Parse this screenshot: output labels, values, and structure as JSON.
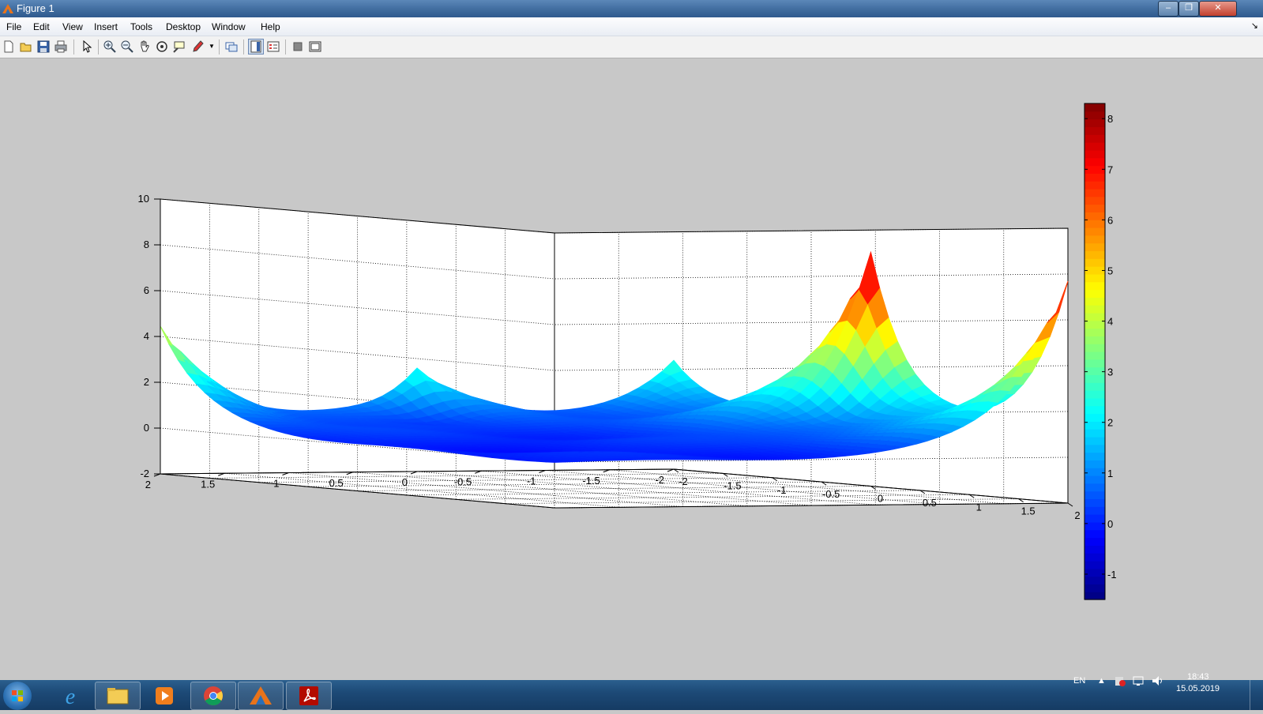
{
  "window": {
    "title": "Figure 1",
    "controls": [
      "minimize",
      "maximize",
      "close"
    ]
  },
  "menu": [
    "File",
    "Edit",
    "View",
    "Insert",
    "Tools",
    "Desktop",
    "Window",
    "Help"
  ],
  "toolbar": [
    "new-figure-icon",
    "open-file-icon",
    "save-icon",
    "print-icon",
    "edit-plot-icon",
    "zoom-in-icon",
    "zoom-out-icon",
    "pan-icon",
    "rotate-3d-icon",
    "data-cursor-icon",
    "brush-icon",
    "link-plot-icon",
    "colorbar-icon",
    "legend-icon",
    "hide-plot-tools-icon",
    "show-plot-tools-icon"
  ],
  "chart_data": {
    "type": "surface",
    "x_ticks": [
      "-2",
      "-1.5",
      "-1",
      "-0.5",
      "0",
      "0.5",
      "1",
      "1.5",
      "2"
    ],
    "y_ticks": [
      "-2",
      "-1.5",
      "-1",
      "-0.5",
      "0",
      "0.5",
      "1",
      "1.5",
      "2"
    ],
    "z_ticks": [
      "-2",
      "0",
      "2",
      "4",
      "6",
      "8",
      "10"
    ],
    "xlim": [
      -2,
      2
    ],
    "ylim": [
      -2,
      2
    ],
    "zlim": [
      -2,
      10
    ],
    "colorbar_ticks": [
      "-1",
      "0",
      "1",
      "2",
      "3",
      "4",
      "5",
      "6",
      "7",
      "8"
    ],
    "colorbar_range": [
      -1.5,
      8.3
    ],
    "colormap": "jet",
    "grid": true,
    "colorbar_location": "right",
    "peaks": [
      {
        "x": 2,
        "y": -2,
        "z": 7.6
      },
      {
        "x": 0,
        "y": -2,
        "z": 8.3
      },
      {
        "x": -2,
        "y": 2,
        "z": 4.4
      },
      {
        "x": -2,
        "y": 0,
        "z": 2.6
      },
      {
        "x": -2,
        "y": -2,
        "z": 2.6
      }
    ]
  },
  "taskbar": {
    "apps": [
      "internet-explorer-icon",
      "file-explorer-icon",
      "media-player-icon",
      "chrome-icon",
      "matlab-icon",
      "acrobat-icon"
    ],
    "language": "EN",
    "time": "18:43",
    "date": "15.05.2019"
  }
}
